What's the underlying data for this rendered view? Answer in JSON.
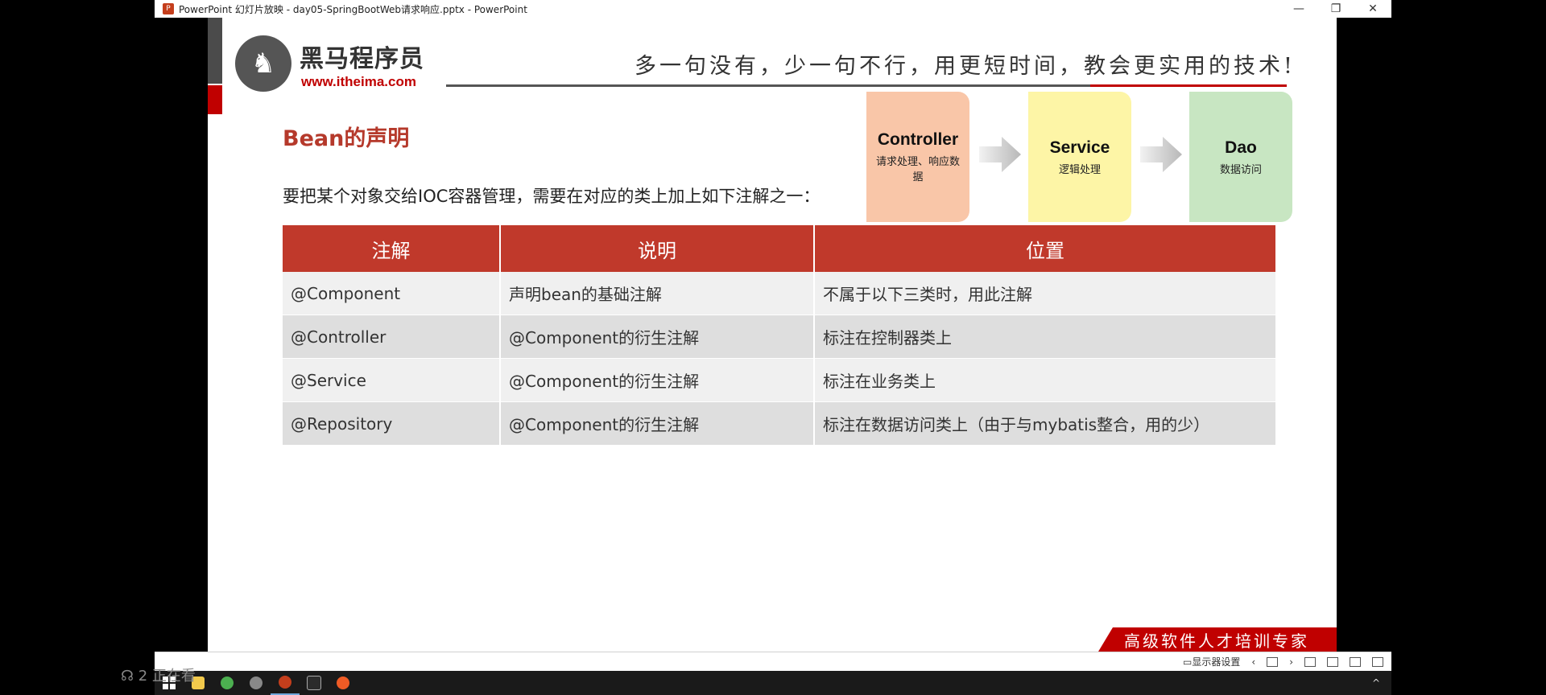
{
  "window": {
    "title": "PowerPoint 幻灯片放映  -  day05-SpringBootWeb请求响应.pptx - PowerPoint",
    "minimize": "—",
    "restore": "❐",
    "close": "✕"
  },
  "slide": {
    "logo_cn": "黑马程序员",
    "logo_url": "www.itheima.com",
    "slogan": "多一句没有，少一句不行，用更短时间，教会更实用的技术!",
    "heading": "Bean的声明",
    "intro": "要把某个对象交给IOC容器管理，需要在对应的类上加上如下注解之一：",
    "flow": [
      {
        "name": "Controller",
        "desc": "请求处理、响应数据",
        "color": "#f9c6a8"
      },
      {
        "name": "Service",
        "desc": "逻辑处理",
        "color": "#fdf5a6"
      },
      {
        "name": "Dao",
        "desc": "数据访问",
        "color": "#c8e6c2"
      }
    ],
    "table": {
      "headers": [
        "注解",
        "说明",
        "位置"
      ],
      "rows": [
        [
          "@Component",
          "声明bean的基础注解",
          "不属于以下三类时，用此注解"
        ],
        [
          "@Controller",
          "@Component的衍生注解",
          "标注在控制器类上"
        ],
        [
          "@Service",
          "@Component的衍生注解",
          "标注在业务类上"
        ],
        [
          "@Repository",
          "@Component的衍生注解",
          "标注在数据访问类上（由于与mybatis整合，用的少）"
        ]
      ]
    },
    "banner": "高级软件人才培训专家"
  },
  "statusbar": {
    "display_settings": "显示器设置"
  },
  "overlay": {
    "viewers": "2 正在看"
  },
  "colors": {
    "header_red": "#c0392b",
    "heading_red": "#b5392b"
  }
}
